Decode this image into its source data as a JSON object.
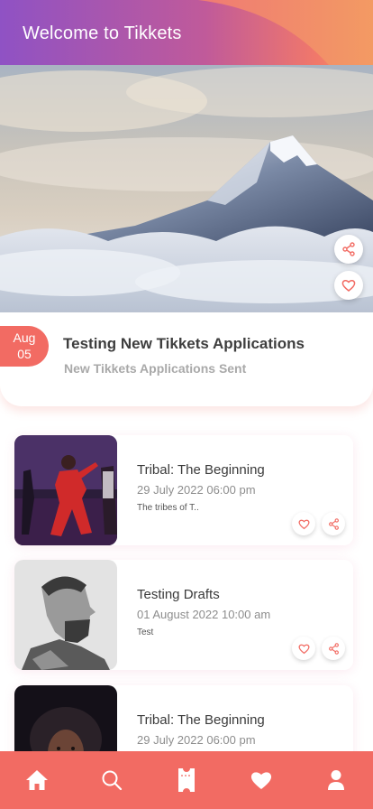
{
  "header": {
    "title": "Welcome to Tikkets"
  },
  "featured": {
    "date_month": "Aug",
    "date_day": "05",
    "title": "Testing New Tikkets Applications",
    "subtitle": "New Tikkets Applications Sent"
  },
  "events": [
    {
      "title": "Tribal: The Beginning",
      "date": "29 July 2022 06:00 pm",
      "description": "The tribes of T..",
      "image": "dancer-photo"
    },
    {
      "title": "Testing Drafts",
      "date": "01 August 2022 10:00 am",
      "description": "Test",
      "image": "man-portrait-photo"
    },
    {
      "title": "Tribal: The Beginning",
      "date": "29 July 2022 06:00 pm",
      "description": "",
      "image": "woman-portrait-photo"
    }
  ],
  "nav": [
    "home-icon",
    "search-icon",
    "ticket-icon",
    "heart-icon",
    "profile-icon"
  ],
  "colors": {
    "accent": "#f26b63",
    "header_start": "#8f52c4",
    "header_end": "#f39a63"
  }
}
